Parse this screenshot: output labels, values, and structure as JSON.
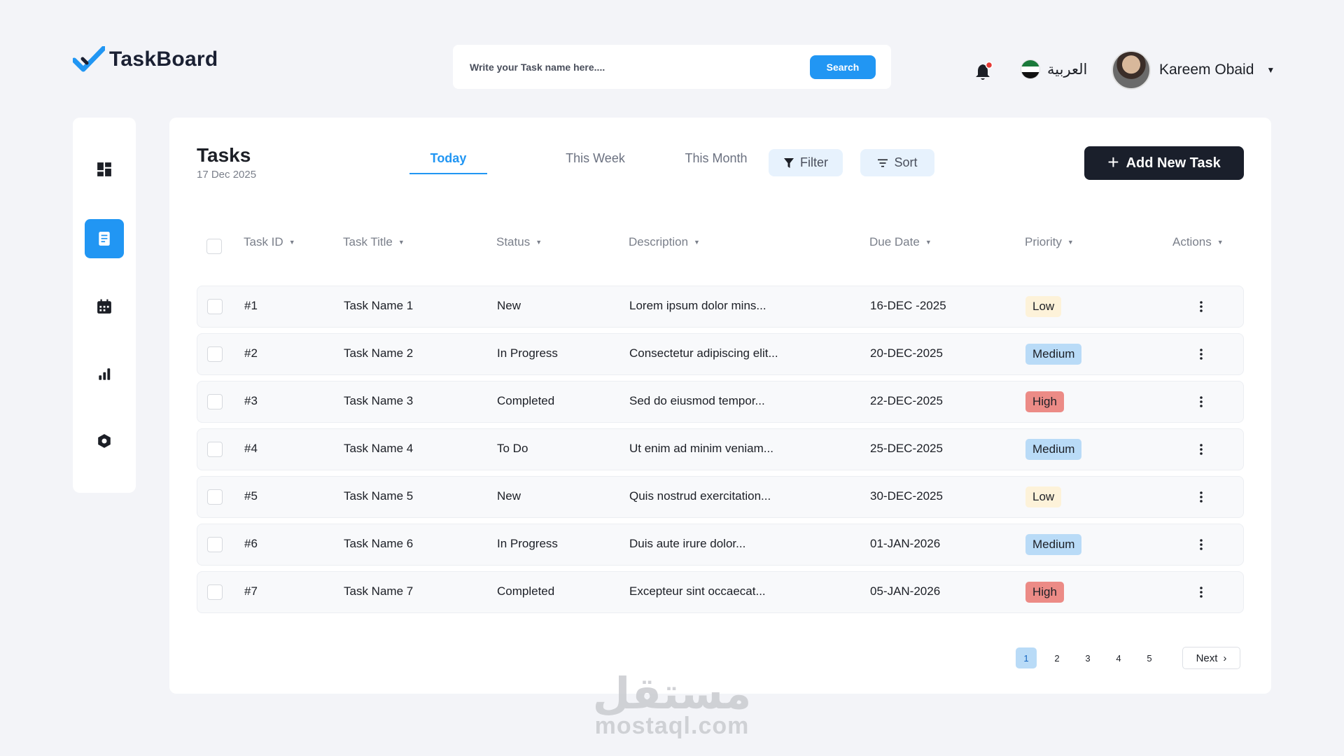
{
  "app": {
    "name": "TaskBoard"
  },
  "search": {
    "placeholder": "Write your Task name here....",
    "button_label": "Search"
  },
  "header": {
    "language_label": "العربية",
    "user_name": "Kareem Obaid",
    "notification_badge_color": "#e53935"
  },
  "sidebar": {
    "items": [
      {
        "icon": "dashboard-icon",
        "active": false
      },
      {
        "icon": "tasks-icon",
        "active": true
      },
      {
        "icon": "calendar-icon",
        "active": false
      },
      {
        "icon": "analytics-icon",
        "active": false
      },
      {
        "icon": "settings-icon",
        "active": false
      }
    ]
  },
  "page": {
    "title": "Tasks",
    "date": "17 Dec 2025"
  },
  "tabs": [
    {
      "label": "Today",
      "active": true
    },
    {
      "label": "This Week",
      "active": false
    },
    {
      "label": "This Month",
      "active": false
    }
  ],
  "toolbar": {
    "filter_label": "Filter",
    "sort_label": "Sort",
    "add_label": "Add New Task"
  },
  "table": {
    "columns": [
      "Task ID",
      "Task Title",
      "Status",
      "Description",
      "Due Date",
      "Priority",
      "Actions"
    ],
    "rows": [
      {
        "id": "#1",
        "title": "Task Name 1",
        "status": "New",
        "description": "Lorem ipsum dolor mins...",
        "due": "16-DEC -2025",
        "priority": "Low"
      },
      {
        "id": "#2",
        "title": "Task Name 2",
        "status": "In Progress",
        "description": "Consectetur adipiscing elit...",
        "due": "20-DEC-2025",
        "priority": "Medium"
      },
      {
        "id": "#3",
        "title": "Task Name 3",
        "status": "Completed",
        "description": "Sed do eiusmod tempor...",
        "due": "22-DEC-2025",
        "priority": "High"
      },
      {
        "id": "#4",
        "title": "Task Name 4",
        "status": "To Do",
        "description": "Ut enim ad minim veniam...",
        "due": "25-DEC-2025",
        "priority": "Medium"
      },
      {
        "id": "#5",
        "title": "Task Name 5",
        "status": "New",
        "description": "Quis nostrud exercitation...",
        "due": "30-DEC-2025",
        "priority": "Low"
      },
      {
        "id": "#6",
        "title": "Task Name 6",
        "status": "In Progress",
        "description": "Duis aute irure dolor...",
        "due": "01-JAN-2026",
        "priority": "Medium"
      },
      {
        "id": "#7",
        "title": "Task Name 7",
        "status": "Completed",
        "description": "Excepteur sint occaecat...",
        "due": "05-JAN-2026",
        "priority": "High"
      }
    ]
  },
  "pagination": {
    "pages": [
      "1",
      "2",
      "3",
      "4",
      "5"
    ],
    "current": "1",
    "next_label": "Next"
  },
  "watermark": {
    "arabic": "مستقل",
    "latin": "mostaql.com"
  },
  "colors": {
    "accent": "#2196f3",
    "dark_button": "#1a1f2b",
    "priority_low": "#fdf2d9",
    "priority_medium": "#b9dbf7",
    "priority_high": "#ec8b86"
  }
}
